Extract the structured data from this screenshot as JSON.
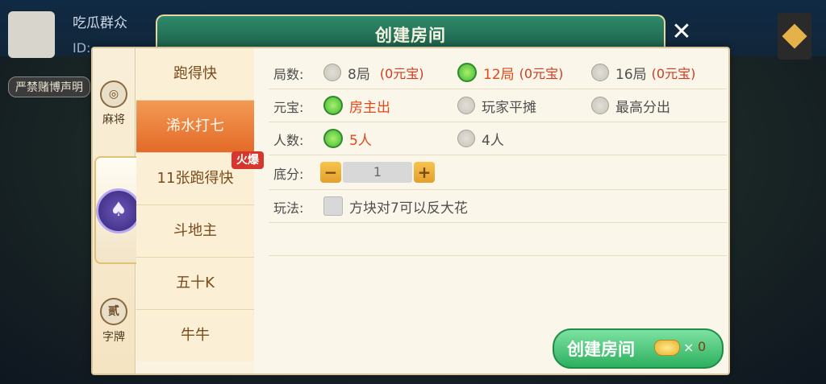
{
  "background": {
    "player_name": "吃瓜群众",
    "id_label": "ID:",
    "notice": "严禁赌博声明"
  },
  "dialog": {
    "title": "创建房间",
    "close_icon": "close-icon"
  },
  "categories": [
    {
      "label": "麻将",
      "icon_text": "◎"
    },
    {
      "label": "",
      "icon_text": "♠"
    },
    {
      "label": "字牌",
      "icon_text": "贰"
    }
  ],
  "games": [
    {
      "label": "跑得快"
    },
    {
      "label": "浠水打七",
      "selected": true
    },
    {
      "label": "11张跑得快",
      "badge": "火爆"
    },
    {
      "label": "斗地主"
    },
    {
      "label": "五十K"
    },
    {
      "label": "牛牛"
    }
  ],
  "settings": {
    "rounds": {
      "label": "局数:",
      "options": [
        {
          "text": "8局",
          "price": "(0元宝)",
          "checked": false
        },
        {
          "text": "12局",
          "price": "(0元宝)",
          "checked": true
        },
        {
          "text": "16局",
          "price": "(0元宝)",
          "checked": false
        }
      ]
    },
    "yuanbao": {
      "label": "元宝:",
      "options": [
        {
          "text": "房主出",
          "checked": true
        },
        {
          "text": "玩家平摊",
          "checked": false
        },
        {
          "text": "最高分出",
          "checked": false
        }
      ]
    },
    "players": {
      "label": "人数:",
      "options": [
        {
          "text": "5人",
          "checked": true
        },
        {
          "text": "4人",
          "checked": false
        }
      ]
    },
    "base": {
      "label": "底分:",
      "value": "1",
      "minus": "−",
      "plus": "+"
    },
    "play": {
      "label": "玩法:",
      "option": "方块对7可以反大花"
    }
  },
  "create": {
    "label": "创建房间",
    "x": "×",
    "cost": "0"
  },
  "colors": {
    "accent_green": "#2db05e",
    "selected_orange": "#e46a28",
    "title_green": "#1c5f49"
  }
}
